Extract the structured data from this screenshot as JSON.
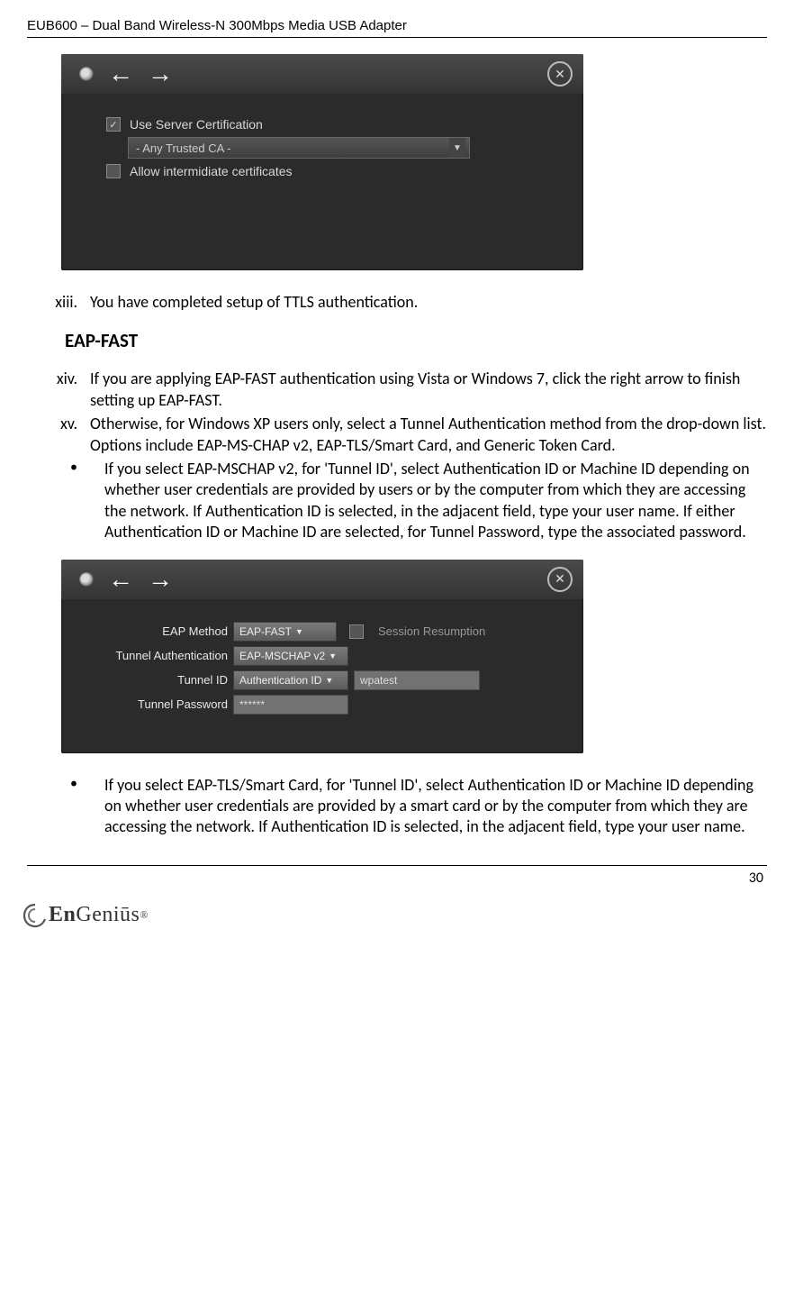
{
  "header": "EUB600 – Dual Band Wireless-N 300Mbps Media USB Adapter",
  "screenshot1": {
    "row1_label": "Use Server Certification",
    "dropdown_value": "- Any Trusted CA -",
    "row2_label": "Allow intermidiate certificates"
  },
  "item_xiii": {
    "marker": "xiii.",
    "text": "You have completed setup of TTLS authentication."
  },
  "heading_eapfast": "EAP-FAST",
  "item_xiv": {
    "marker": "xiv.",
    "text": "If you are applying EAP-FAST authentication using Vista or Windows 7, click the right arrow to finish setting up EAP-FAST."
  },
  "item_xv": {
    "marker": "xv.",
    "text": "Otherwise, for Windows XP users only, select a Tunnel Authentication method from the drop-down list. Options include EAP-MS-CHAP v2, EAP-TLS/Smart Card, and Generic Token Card."
  },
  "bullet1": {
    "marker": "•",
    "text": "If you select EAP-MSCHAP v2, for 'Tunnel ID', select Authentication ID or Machine ID depending on whether user credentials are provided by users or by the computer from which they are accessing the network. If Authentication ID is selected, in the adjacent field, type your user name. If either Authentication ID or Machine ID are selected, for Tunnel Password, type the associated password."
  },
  "screenshot2": {
    "eap_method_label": "EAP Method",
    "eap_method_value": "EAP-FAST",
    "session_resumption": "Session Resumption",
    "tunnel_auth_label": "Tunnel Authentication",
    "tunnel_auth_value": "EAP-MSCHAP v2",
    "tunnel_id_label": "Tunnel ID",
    "tunnel_id_type": "Authentication ID",
    "tunnel_id_value": "wpatest",
    "tunnel_pw_label": "Tunnel Password",
    "tunnel_pw_value": "******"
  },
  "bullet2": {
    "marker": "•",
    "text": "If you select EAP-TLS/Smart Card, for 'Tunnel ID', select Authentication ID or Machine ID depending on whether user credentials are provided by a smart card or by the computer from which they are accessing the network. If Authentication ID is selected, in the adjacent field, type your user name."
  },
  "page_number": "30",
  "logo_text": "EnGenius"
}
